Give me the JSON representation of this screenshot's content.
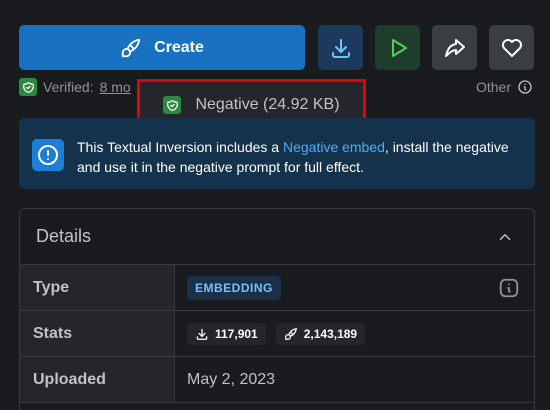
{
  "actions": {
    "create_label": "Create"
  },
  "verified": {
    "label": "Verified:",
    "date": "8 mo"
  },
  "license": {
    "label": "Other"
  },
  "popover": {
    "text": "Negative (24.92 KB)"
  },
  "alert": {
    "text_before": "This Textual Inversion includes a ",
    "link_text": "Negative embed",
    "text_after": ", install the negative and use it in the negative prompt for full effect."
  },
  "details": {
    "title": "Details",
    "rows": {
      "type_label": "Type",
      "type_value": "EMBEDDING",
      "stats_label": "Stats",
      "downloads": "117,901",
      "generations": "2,143,189",
      "uploaded_label": "Uploaded",
      "uploaded_value": "May 2, 2023"
    }
  },
  "colors": {
    "primary": "#1971c2",
    "verified_green": "#2b8a3e",
    "alert_bg": "#14324b",
    "highlight_red": "#e3000f"
  }
}
